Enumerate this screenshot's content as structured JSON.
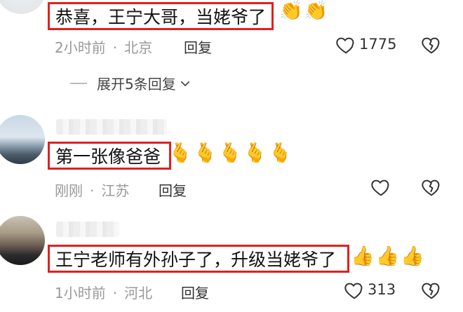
{
  "comments": [
    {
      "text": "恭喜，王宁大哥，当姥爷了",
      "emoji": "👏👏",
      "time": "2小时前",
      "location": "北京",
      "reply_label": "回复",
      "like_count": "1775",
      "expand_label": "展开5条回复"
    },
    {
      "text": "第一张像爸爸",
      "emoji": "🫰🫰🫰🫰🫰",
      "time": "刚刚",
      "location": "江苏",
      "reply_label": "回复",
      "like_count": ""
    },
    {
      "text": "王宁老师有外孙子了，升级当姥爷了",
      "emoji": "👍👍👍",
      "time": "1小时前",
      "location": "河北",
      "reply_label": "回复",
      "like_count": "313"
    }
  ],
  "highlight_color": "#e02020",
  "icons": {
    "like": "heart-outline-icon",
    "dislike": "broken-heart-icon",
    "expand": "chevron-down-icon"
  }
}
